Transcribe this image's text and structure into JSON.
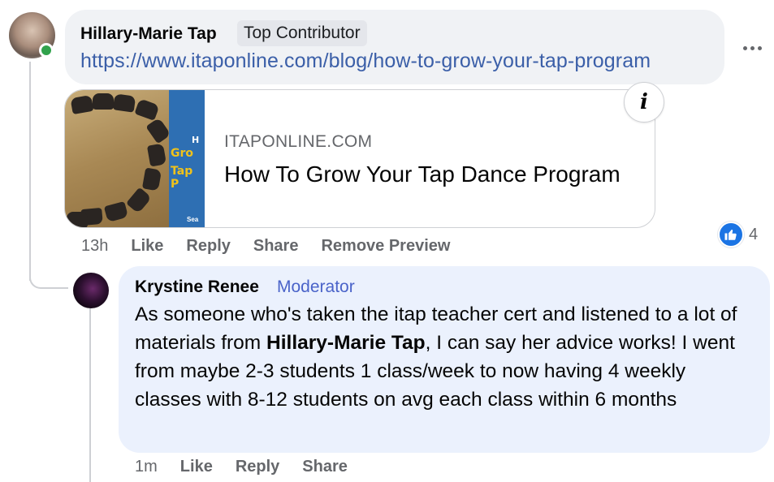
{
  "comment_1": {
    "author": "Hillary-Marie Tap",
    "badge": "Top Contributor",
    "link": "https://www.itaponline.com/blog/how-to-grow-your-tap-program",
    "preview": {
      "domain": "ITAPONLINE.COM",
      "title": "How To Grow Your Tap Dance Program",
      "thumb_text_1": "H",
      "thumb_text_2": "Gro",
      "thumb_text_3": "Tap P",
      "thumb_text_4": "Sea"
    },
    "time": "13h",
    "actions": {
      "like": "Like",
      "reply": "Reply",
      "share": "Share",
      "remove_preview": "Remove Preview"
    },
    "reaction_count": "4",
    "reaction_icon": "like-icon"
  },
  "comment_2": {
    "author": "Krystine Renee",
    "badge": "Moderator",
    "text_part_1": "As someone who's taken the itap teacher cert and listened to a lot of materials from ",
    "text_mention": "Hillary-Marie Tap",
    "text_part_2": ", I can say her advice works! I went from maybe 2-3 students 1 class/week to now having 4 weekly classes with 8-12 students on avg each class within 6 months",
    "time": "1m",
    "actions": {
      "like": "Like",
      "reply": "Reply",
      "share": "Share"
    }
  },
  "colors": {
    "bubble": "#f0f2f5",
    "reply_bubble": "#ebf1fd",
    "link": "#3b5fa8",
    "moderator": "#4a63c9",
    "like_blue": "#1b74e4",
    "online": "#31a24c"
  }
}
